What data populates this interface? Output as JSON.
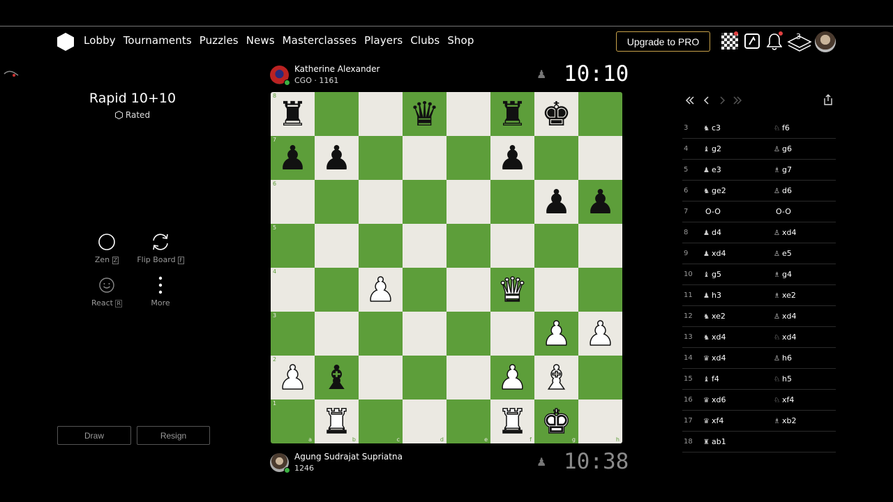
{
  "nav": {
    "items": [
      "Lobby",
      "Tournaments",
      "Puzzles",
      "News",
      "Masterclasses",
      "Players",
      "Clubs",
      "Shop"
    ],
    "upgrade_label": "Upgrade to PRO",
    "games_count": "3"
  },
  "game": {
    "title": "Rapid 10+10",
    "rated": "Rated"
  },
  "tools": {
    "zen": "Zen",
    "flip": "Flip Board",
    "react": "React",
    "more": "More"
  },
  "actions": {
    "draw": "Draw",
    "resign": "Resign"
  },
  "opponent": {
    "name": "Katherine Alexander",
    "country": "CGO",
    "rating": "1161",
    "clock": "10:10"
  },
  "player": {
    "name": "Agung Sudrajat Supriatna",
    "rating": "1246",
    "clock": "10:38"
  },
  "board": {
    "ranks": [
      "8",
      "7",
      "6",
      "5",
      "4",
      "3",
      "2",
      "1"
    ],
    "files": [
      "a",
      "b",
      "c",
      "d",
      "e",
      "f",
      "g",
      "h"
    ],
    "position": [
      [
        "r",
        "",
        "",
        "q",
        "",
        "r",
        "k",
        ""
      ],
      [
        "p",
        "p",
        "",
        "",
        "",
        "p",
        "",
        ""
      ],
      [
        "",
        "",
        "",
        "",
        "",
        "",
        "p",
        "p"
      ],
      [
        "",
        "",
        "",
        "",
        "",
        "",
        "",
        ""
      ],
      [
        "",
        "",
        "P",
        "",
        "",
        "Q",
        "",
        ""
      ],
      [
        "",
        "",
        "",
        "",
        "",
        "",
        "P",
        "P"
      ],
      [
        "P",
        "b",
        "",
        "",
        "",
        "P",
        "B",
        ""
      ],
      [
        "",
        "R",
        "",
        "",
        "",
        "R",
        "K",
        ""
      ]
    ]
  },
  "moves": [
    {
      "num": "3",
      "white": "c3",
      "white_fig": "♞",
      "black": "f6",
      "black_fig": "♘"
    },
    {
      "num": "4",
      "white": "g2",
      "white_fig": "♝",
      "black": "g6",
      "black_fig": "♙"
    },
    {
      "num": "5",
      "white": "e3",
      "white_fig": "♟",
      "black": "g7",
      "black_fig": "♗"
    },
    {
      "num": "6",
      "white": "ge2",
      "white_fig": "♞",
      "black": "d6",
      "black_fig": "♙"
    },
    {
      "num": "7",
      "white": "O-O",
      "white_fig": "",
      "black": "O-O",
      "black_fig": ""
    },
    {
      "num": "8",
      "white": "d4",
      "white_fig": "♟",
      "black": "xd4",
      "black_fig": "♙"
    },
    {
      "num": "9",
      "white": "xd4",
      "white_fig": "♟",
      "black": "e5",
      "black_fig": "♙"
    },
    {
      "num": "10",
      "white": "g5",
      "white_fig": "♝",
      "black": "g4",
      "black_fig": "♗"
    },
    {
      "num": "11",
      "white": "h3",
      "white_fig": "♟",
      "black": "xe2",
      "black_fig": "♗"
    },
    {
      "num": "12",
      "white": "xe2",
      "white_fig": "♞",
      "black": "xd4",
      "black_fig": "♙"
    },
    {
      "num": "13",
      "white": "xd4",
      "white_fig": "♞",
      "black": "xd4",
      "black_fig": "♘"
    },
    {
      "num": "14",
      "white": "xd4",
      "white_fig": "♛",
      "black": "h6",
      "black_fig": "♙"
    },
    {
      "num": "15",
      "white": "f4",
      "white_fig": "♝",
      "black": "h5",
      "black_fig": "♘"
    },
    {
      "num": "16",
      "white": "xd6",
      "white_fig": "♛",
      "black": "xf4",
      "black_fig": "♘"
    },
    {
      "num": "17",
      "white": "xf4",
      "white_fig": "♛",
      "black": "xb2",
      "black_fig": "♗"
    },
    {
      "num": "18",
      "white": "ab1",
      "white_fig": "♜",
      "black": "",
      "black_fig": ""
    }
  ],
  "colors": {
    "light_square": "#ebe9e2",
    "dark_square": "#5d9e3a",
    "upgrade_border": "#c8a24a"
  }
}
